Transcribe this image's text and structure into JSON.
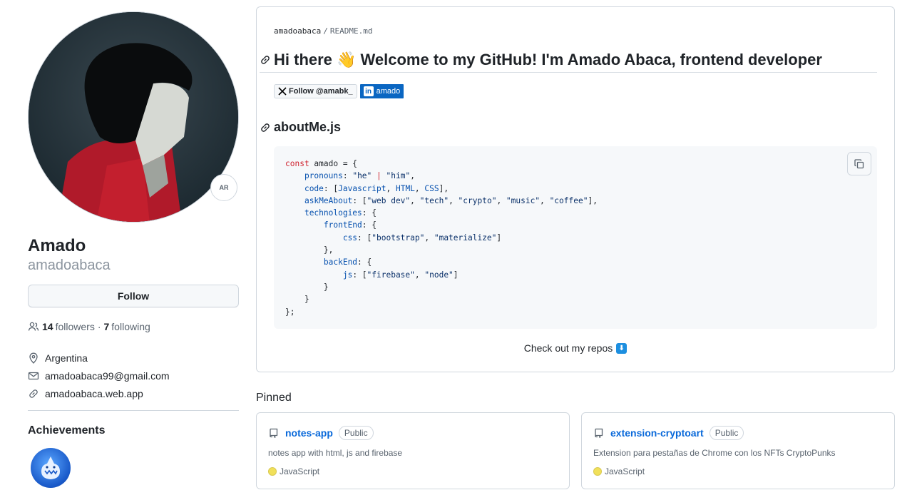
{
  "profile": {
    "avatar_status_text": "AR",
    "display_name": "Amado",
    "username": "amadoabaca",
    "follow_label": "Follow",
    "followers_count": "14",
    "followers_label": "followers",
    "separator": "·",
    "following_count": "7",
    "following_label": "following",
    "location": "Argentina",
    "email": "amadoabaca99@gmail.com",
    "website": "amadoabaca.web.app",
    "achievements_title": "Achievements"
  },
  "readme": {
    "crumb_user": "amadoabaca",
    "crumb_sep": "/",
    "crumb_file": "README.md",
    "heading": "Hi there 👋 Welcome to my GitHub! I'm Amado Abaca, frontend developer",
    "badge_x": "Follow @amabk_",
    "badge_linkedin": "amado",
    "subheading": "aboutMe.js",
    "code_lines": [
      "const amado = {",
      "    pronouns: \"he\" | \"him\",",
      "    code: [Javascript, HTML, CSS],",
      "    askMeAbout: [\"web dev\", \"tech\", \"crypto\", \"music\", \"coffee\"],",
      "    technologies: {",
      "        frontEnd: {",
      "            css: [\"bootstrap\", \"materialize\"]",
      "        },",
      "        backEnd: {",
      "            js: [\"firebase\", \"node\"]",
      "        }",
      "    }",
      "};"
    ],
    "repos_text": "Check out my repos",
    "repos_emoji": "⬇"
  },
  "pinned": {
    "title": "Pinned",
    "repos": [
      {
        "name": "notes-app",
        "visibility": "Public",
        "description": "notes app with html, js and firebase",
        "language": "JavaScript"
      },
      {
        "name": "extension-cryptoart",
        "visibility": "Public",
        "description": "Extension para pestañas de Chrome con los NFTs CryptoPunks",
        "language": "JavaScript"
      }
    ]
  },
  "colors": {
    "link": "#0969da",
    "javascript": "#f1e05a",
    "linkedin": "#0a66c2"
  }
}
